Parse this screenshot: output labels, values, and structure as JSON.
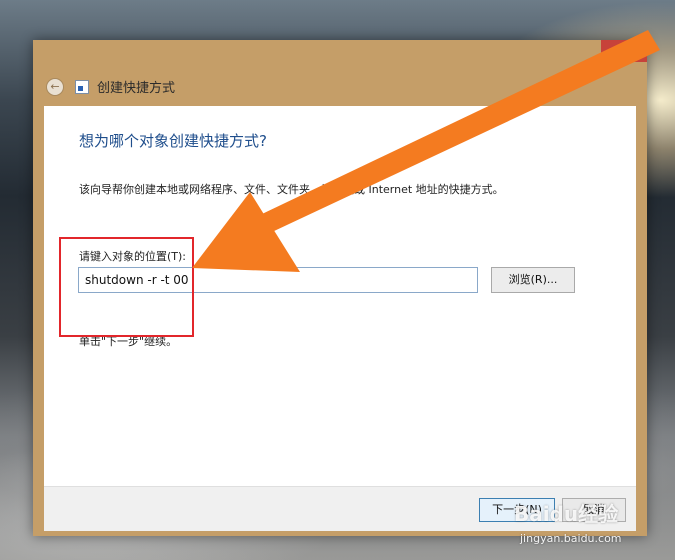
{
  "window": {
    "title": "创建快捷方式",
    "close_glyph": "✕",
    "back_glyph": "←"
  },
  "wizard": {
    "heading": "想为哪个对象创建快捷方式?",
    "description": "该向导帮你创建本地或网络程序、文件、文件夹、计算机或 Internet 地址的快捷方式。",
    "location_label": "请键入对象的位置(T):",
    "location_value": "shutdown -r -t 00",
    "browse_label": "浏览(R)...",
    "hint": "单击\"下一步\"继续。"
  },
  "footer": {
    "next_label": "下一步(N)",
    "cancel_label": "取消"
  },
  "annotations": {
    "arrow_color": "#f47b20",
    "box_color": "#e2262b"
  },
  "watermark": {
    "logo": "Baidu经验",
    "url": "jingyan.baidu.com"
  },
  "colors": {
    "window_frame": "#c59e68",
    "close_button": "#c7423a",
    "heading_text": "#1f4e8c"
  }
}
